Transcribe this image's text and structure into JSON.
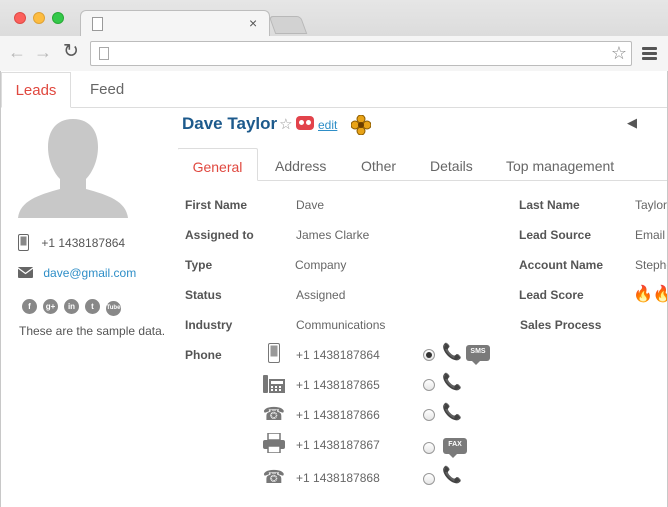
{
  "browser": {
    "tab_close_glyph": "×",
    "back_glyph": "←",
    "forward_glyph": "→",
    "reload_glyph": "↻",
    "bookmark_glyph": "☆"
  },
  "app_tabs": [
    {
      "label": "Leads",
      "active": true
    },
    {
      "label": "Feed",
      "active": false
    }
  ],
  "sidebar": {
    "phone": "+1 1438187864",
    "email": "dave@gmail.com",
    "socials": [
      {
        "icon": "facebook-icon",
        "glyph": "f"
      },
      {
        "icon": "google-plus-icon",
        "glyph": "g+"
      },
      {
        "icon": "linkedin-icon",
        "glyph": "in"
      },
      {
        "icon": "twitter-icon",
        "glyph": "t"
      },
      {
        "icon": "youtube-icon",
        "glyph": "Tube"
      }
    ],
    "note": "These are the sample data."
  },
  "header": {
    "name": "Dave Taylor",
    "star_glyph": "☆",
    "edit_label": "edit",
    "collapse_glyph": "◀"
  },
  "sub_tabs": [
    "General",
    "Address",
    "Other",
    "Details",
    "Top management"
  ],
  "fields_left": [
    {
      "label": "First Name",
      "value": "Dave"
    },
    {
      "label": "Assigned to",
      "value": "James Clarke"
    },
    {
      "label": "Type",
      "value": "Company"
    },
    {
      "label": "Status",
      "value": "Assigned"
    },
    {
      "label": "Industry",
      "value": "Communications"
    },
    {
      "label": "Phone",
      "value": ""
    }
  ],
  "fields_right": [
    {
      "label": "Last Name",
      "value": "Taylor"
    },
    {
      "label": "Lead Source",
      "value": "Email"
    },
    {
      "label": "Account Name",
      "value": "Stephen"
    },
    {
      "label": "Lead Score",
      "value": ""
    },
    {
      "label": "Sales Process",
      "value": ""
    }
  ],
  "lead_score_flames": "🔥🔥",
  "phones": [
    {
      "icon": "mobile-phone-icon",
      "glyph": "▯",
      "number": "+1 1438187864",
      "selected": true,
      "badge": "SMS"
    },
    {
      "icon": "office-phone-icon",
      "glyph": "☏",
      "number": "+1 1438187865",
      "selected": false,
      "badge": ""
    },
    {
      "icon": "home-phone-icon",
      "glyph": "☎",
      "number": "+1 1438187866",
      "selected": false,
      "badge": ""
    },
    {
      "icon": "fax-icon",
      "glyph": "⎙",
      "number": "+1 1438187867",
      "selected": false,
      "badge": "FAX"
    },
    {
      "icon": "landline-phone-icon",
      "glyph": "☎",
      "number": "+1 1438187868",
      "selected": false,
      "badge": ""
    }
  ],
  "colors": {
    "accent": "#e0483f",
    "link": "#2e8ec7",
    "name": "#1d5a8c"
  }
}
